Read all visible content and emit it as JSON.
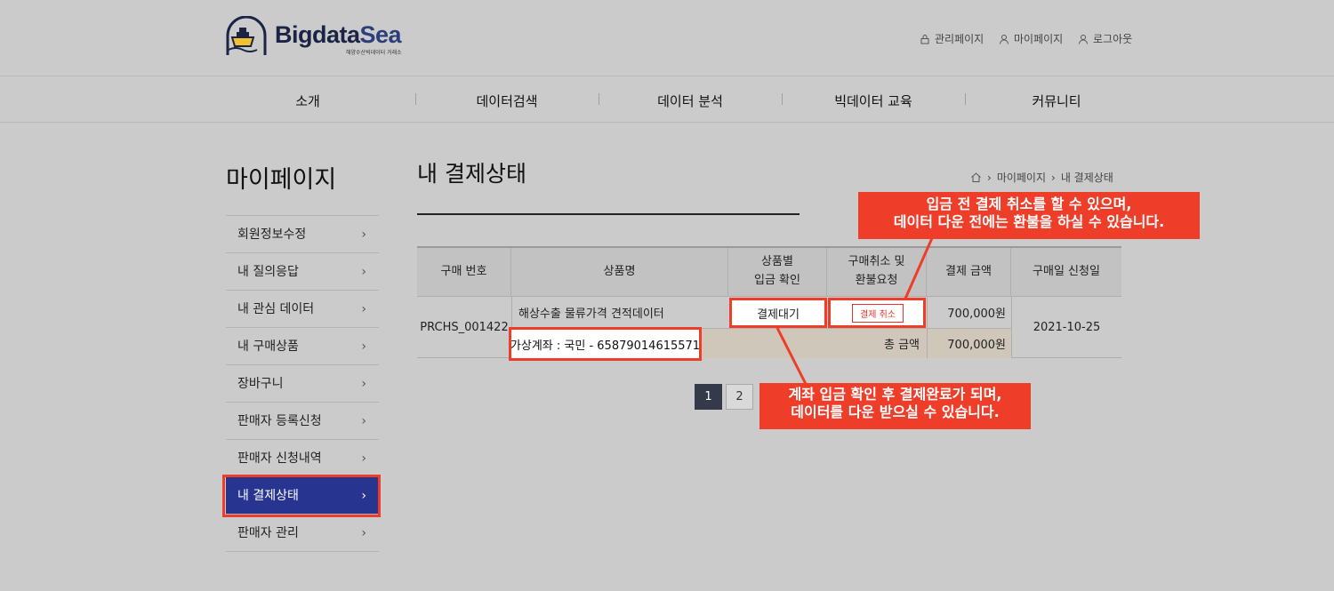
{
  "header": {
    "logo_text_main": "Bigdata",
    "logo_text_accent": "Sea",
    "logo_subtitle": "해양수산빅데이터 거래소",
    "util_links": [
      {
        "label": "관리페이지",
        "icon": "lock-icon"
      },
      {
        "label": "마이페이지",
        "icon": "user-icon"
      },
      {
        "label": "로그아웃",
        "icon": "user-icon"
      }
    ]
  },
  "nav": {
    "items": [
      "소개",
      "데이터검색",
      "데이터 분석",
      "빅데이터 교육",
      "커뮤니티"
    ]
  },
  "sidebar": {
    "title": "마이페이지",
    "items": [
      {
        "label": "회원정보수정"
      },
      {
        "label": "내 질의응답"
      },
      {
        "label": "내 관심 데이터"
      },
      {
        "label": "내 구매상품"
      },
      {
        "label": "장바구니"
      },
      {
        "label": "판매자 등록신청"
      },
      {
        "label": "판매자 신청내역"
      },
      {
        "label": "내 결제상태"
      },
      {
        "label": "판매자 관리"
      }
    ],
    "active_index": 7
  },
  "page": {
    "title": "내 결제상태",
    "breadcrumb": [
      "마이페이지",
      "내 결제상태"
    ]
  },
  "table": {
    "headers": {
      "order_no": "구매 번호",
      "product": "상품명",
      "deposit_line1": "상품별",
      "deposit_line2": "입금 확인",
      "cancel_line1": "구매취소 및",
      "cancel_line2": "환불요청",
      "amount": "결제 금액",
      "date": "구매일 신청일"
    },
    "row": {
      "order_no": "PRCHS_001422",
      "product": "해상수출 물류가격 견적데이터",
      "deposit_status": "결제대기",
      "cancel_button": "결제 취소",
      "amount": "700,000원",
      "date": "2021-10-25",
      "account": "가상계좌 : 국민 - 65879014615571",
      "total_label": "총 금액",
      "total_amount": "700,000원"
    }
  },
  "pagination": {
    "pages": [
      "1",
      "2"
    ],
    "current": "1"
  },
  "callouts": {
    "top_line1": "입금 전 결제 취소를 할 수 있으며,",
    "top_line2": "데이터 다운 전에는 환불을 하실 수 있습니다.",
    "bottom_line1": "계좌 입금 확인 후 결제완료가 되며,",
    "bottom_line2": "데이터를 다운 받으실 수 있습니다."
  },
  "colors": {
    "background": "#cbcbcb",
    "active_nav": "#273590",
    "highlight": "#ee3d29",
    "pagination_active": "#353a4a",
    "total_row": "#cfc7ba"
  }
}
